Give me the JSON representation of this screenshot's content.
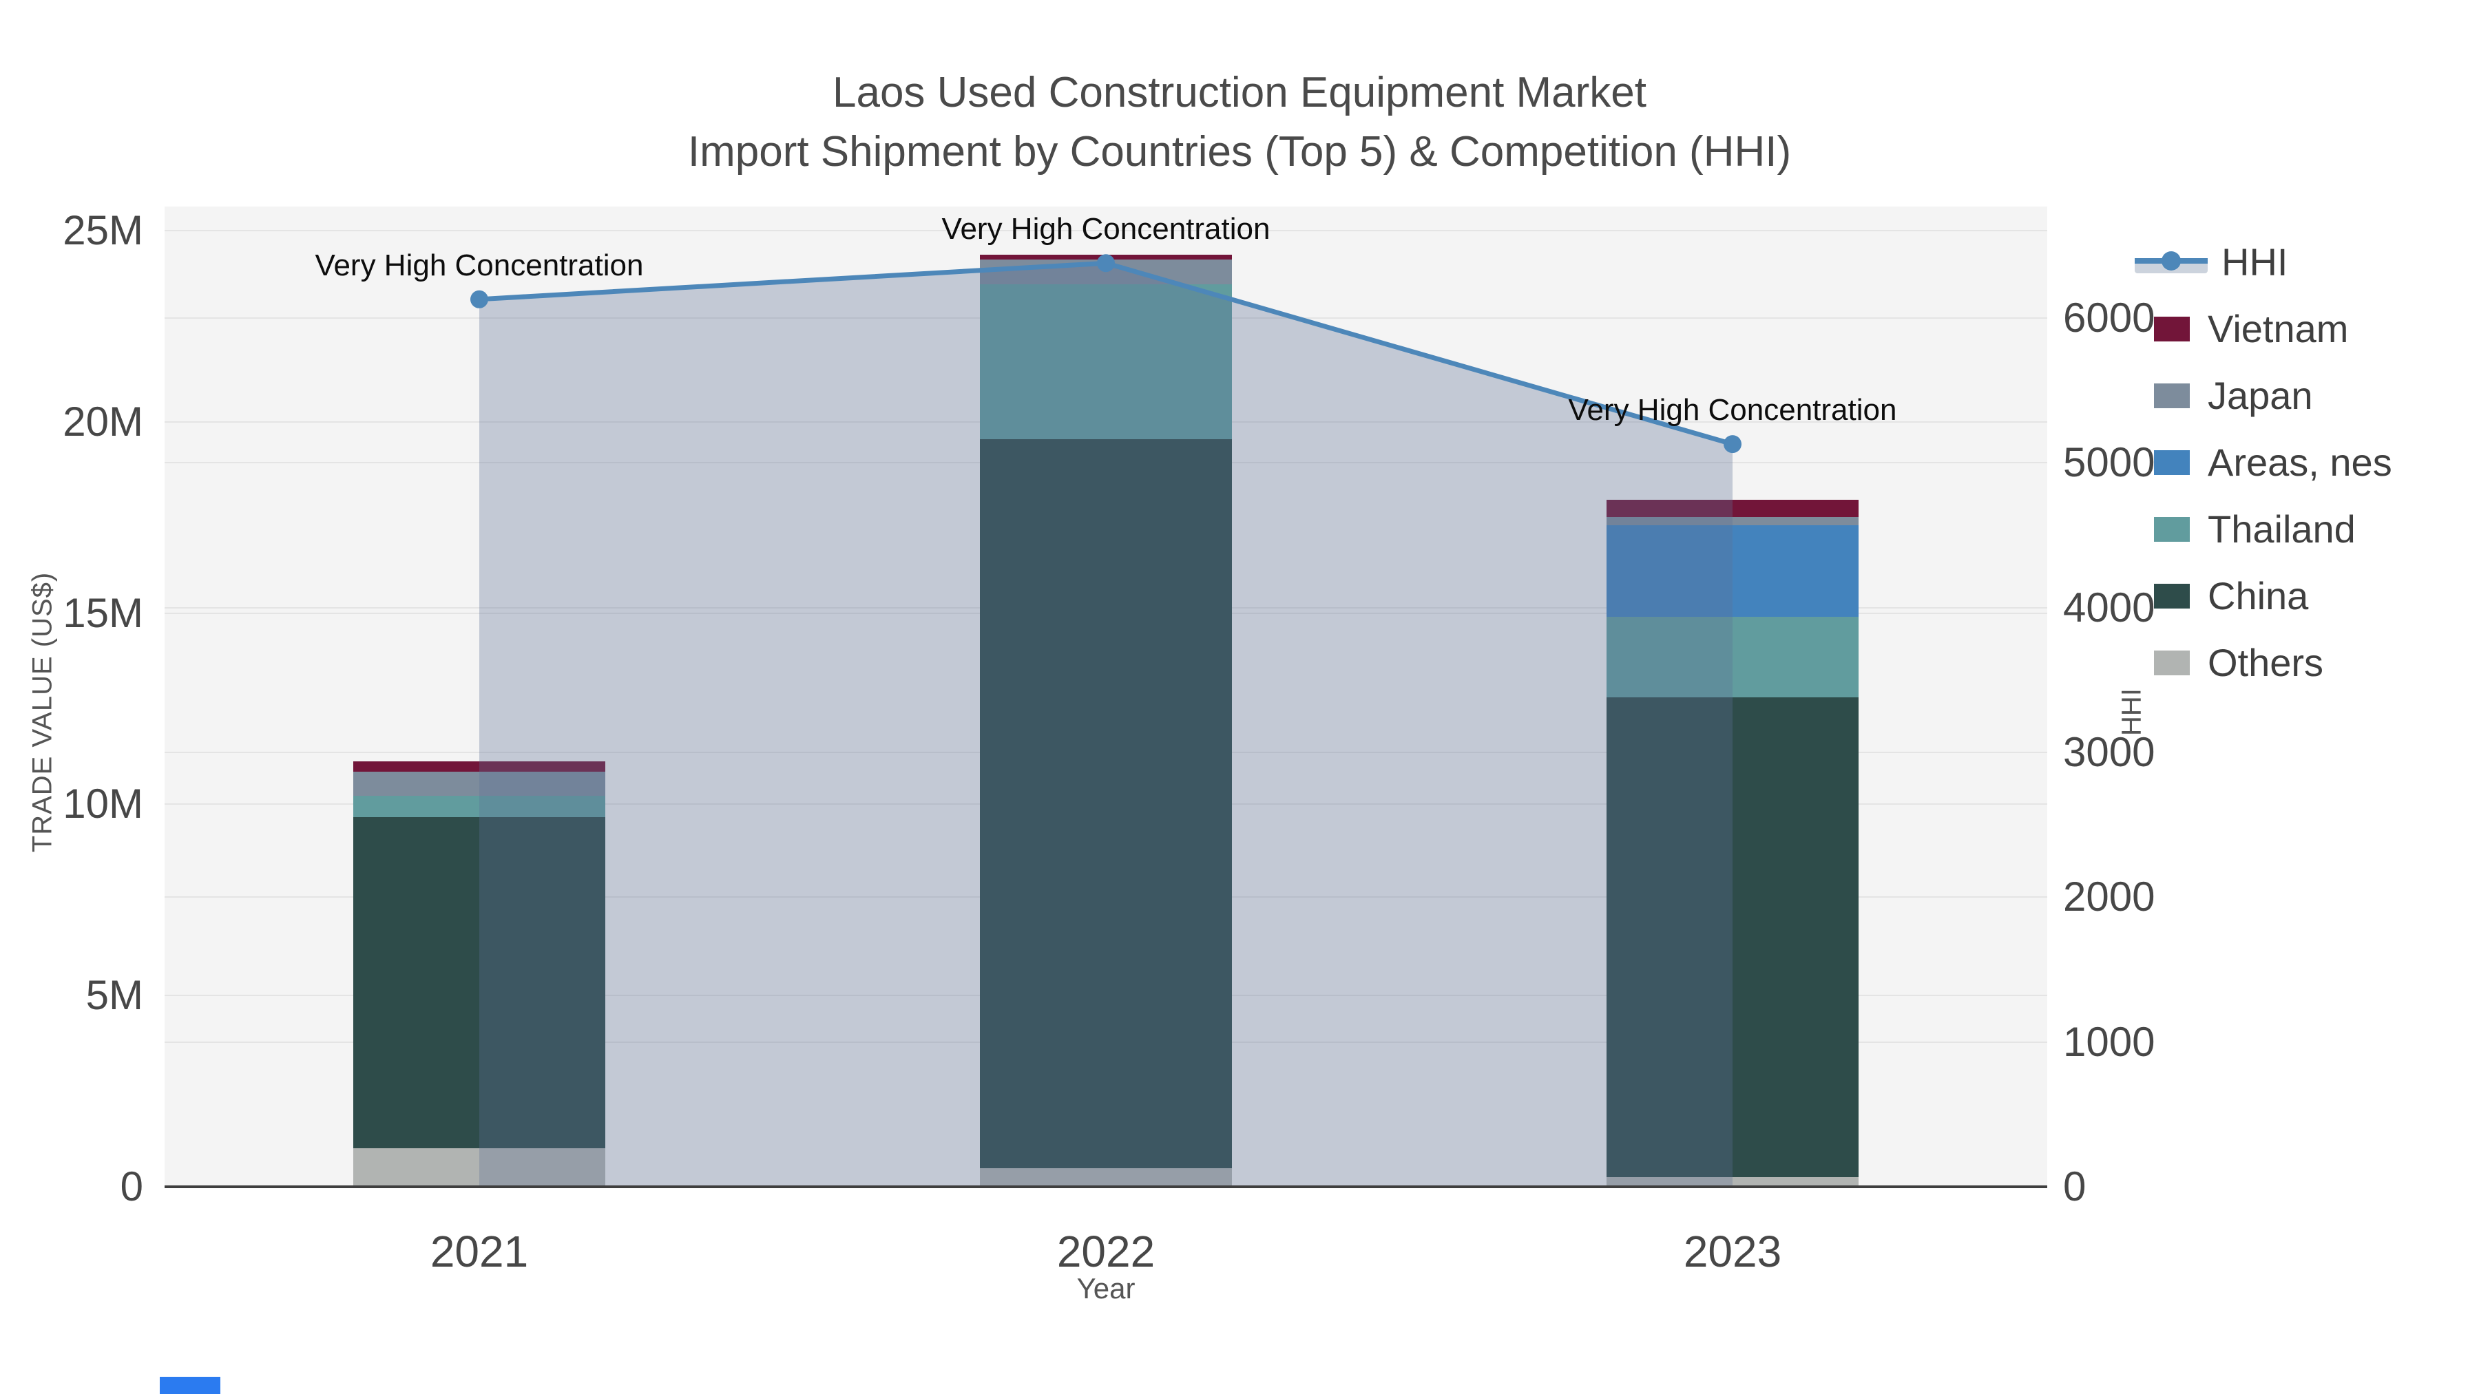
{
  "title": {
    "line1": "Laos Used Construction Equipment Market",
    "line2": "Import Shipment by Countries (Top 5) & Competition (HHI)"
  },
  "chart_data": {
    "type": "bar+line",
    "title": "Laos Used Construction Equipment Market — Import Shipment by Countries (Top 5) & Competition (HHI)",
    "categories": [
      "2021",
      "2022",
      "2023"
    ],
    "bar_value_unit": "US$ millions",
    "stack_series_bottom_to_top": [
      {
        "name": "Others",
        "color": "#b1b4b2",
        "values": [
          1.01,
          0.49,
          0.25
        ]
      },
      {
        "name": "China",
        "color": "#2e4c4a",
        "values": [
          8.66,
          19.06,
          12.54
        ]
      },
      {
        "name": "Thailand",
        "color": "#619c9e",
        "values": [
          0.56,
          4.05,
          2.12
        ]
      },
      {
        "name": "Areas, nes",
        "color": "#4383bd",
        "values": [
          0,
          0,
          2.38
        ]
      },
      {
        "name": "Japan",
        "color": "#7d8c9c",
        "values": [
          0.63,
          0.65,
          0.23
        ]
      },
      {
        "name": "Vietnam",
        "color": "#721539",
        "values": [
          0.27,
          0.12,
          0.45
        ]
      }
    ],
    "bar_totals_musd": [
      11.13,
      24.37,
      17.97
    ],
    "line_series": {
      "name": "HHI",
      "color": "#4d87b9",
      "area_fill": "rgba(93,112,150,0.32)",
      "values": [
        6130,
        6380,
        5130
      ]
    },
    "annotations": [
      {
        "text": "Very High Concentration",
        "category_index": 0
      },
      {
        "text": "Very High Concentration",
        "category_index": 1
      },
      {
        "text": "Very High Concentration",
        "category_index": 2
      }
    ],
    "x_axis": {
      "label": "Year"
    },
    "y_left_axis": {
      "label": "TRADE VALUE (US$)",
      "max_musd": 25.63,
      "ticks": [
        {
          "value": 0,
          "label": "0"
        },
        {
          "value": 5,
          "label": "5M"
        },
        {
          "value": 10,
          "label": "10M"
        },
        {
          "value": 15,
          "label": "15M"
        },
        {
          "value": 20,
          "label": "20M"
        },
        {
          "value": 25,
          "label": "25M"
        }
      ]
    },
    "y_right_axis": {
      "label": "HHI",
      "max": 6771,
      "ticks": [
        {
          "value": 0,
          "label": "0"
        },
        {
          "value": 1000,
          "label": "1000"
        },
        {
          "value": 2000,
          "label": "2000"
        },
        {
          "value": 3000,
          "label": "3000"
        },
        {
          "value": 4000,
          "label": "4000"
        },
        {
          "value": 5000,
          "label": "5000"
        },
        {
          "value": 6000,
          "label": "6000"
        }
      ]
    },
    "grid": true,
    "plot_background": "#f4f4f4",
    "grid_color": "#e4e4e4",
    "axis_line_color": "#3f3f3f",
    "legend_position": "right"
  },
  "legend": {
    "items": [
      {
        "label": "HHI",
        "type": "line",
        "color": "#4d87b9"
      },
      {
        "label": "Vietnam",
        "type": "swatch",
        "color": "#721539"
      },
      {
        "label": "Japan",
        "type": "swatch",
        "color": "#7d8c9c"
      },
      {
        "label": "Areas, nes",
        "type": "swatch",
        "color": "#4383bd"
      },
      {
        "label": "Thailand",
        "type": "swatch",
        "color": "#619c9e"
      },
      {
        "label": "China",
        "type": "swatch",
        "color": "#2e4c4a"
      },
      {
        "label": "Others",
        "type": "swatch",
        "color": "#b1b4b2"
      }
    ]
  }
}
